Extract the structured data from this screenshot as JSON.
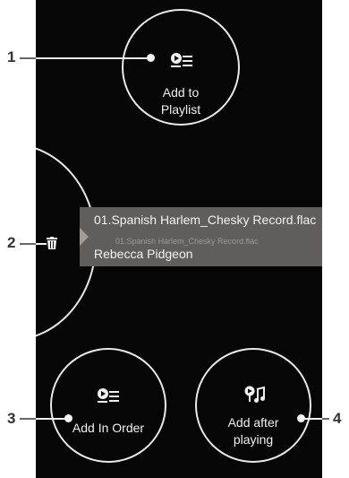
{
  "actions": {
    "add_to_playlist": {
      "label_line1": "Add to",
      "label_line2": "Playlist",
      "icon": "add-to-playlist-icon"
    },
    "add_in_order": {
      "label": "Add In Order",
      "icon": "add-in-order-icon"
    },
    "add_after_playing": {
      "label_line1": "Add after",
      "label_line2": "playing",
      "icon": "play-next-icon"
    },
    "delete": {
      "icon": "trash-icon"
    }
  },
  "now_playing": {
    "title": "01.Spanish Harlem_Chesky Record.flac",
    "artist": "Rebecca Pidgeon",
    "ghost_text": "01.Spanish Harlem_Chesky Record.flac"
  },
  "callouts": [
    "1",
    "2",
    "3",
    "4"
  ],
  "colors": {
    "background": "#060606",
    "circle_stroke": "#e9e9e9",
    "card": "#5f5e5c"
  }
}
